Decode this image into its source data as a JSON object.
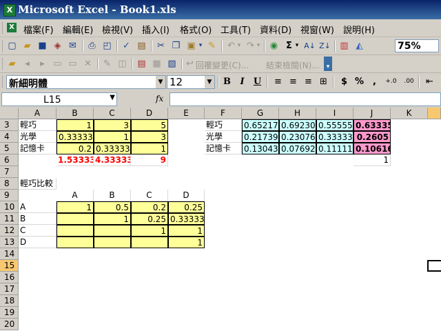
{
  "window": {
    "title": "Microsoft Excel - Book1.xls",
    "app_icon": "excel-icon"
  },
  "menu": [
    "檔案(F)",
    "編輯(E)",
    "檢視(V)",
    "插入(I)",
    "格式(O)",
    "工具(T)",
    "資料(D)",
    "視窗(W)",
    "說明(H)"
  ],
  "toolbar": {
    "zoom": "75%"
  },
  "reviewing_toolbar": {
    "reply_label": "回覆變更(C)...",
    "end_review_label": "結束檢閱(N)..."
  },
  "format_toolbar": {
    "font": "新細明體",
    "size": "12",
    "bold": "B",
    "italic": "I",
    "underline": "U",
    "currency": "$",
    "percent": "%",
    "comma": ","
  },
  "formula_bar": {
    "name_box": "L15",
    "fx": "fx",
    "content": ""
  },
  "columns": [
    "A",
    "B",
    "C",
    "D",
    "E",
    "F",
    "G",
    "H",
    "I",
    "J",
    "K"
  ],
  "rows": [
    "3",
    "4",
    "5",
    "6",
    "7",
    "8",
    "9",
    "10",
    "11",
    "12",
    "13",
    "14",
    "15",
    "16",
    "17",
    "18",
    "19",
    "20"
  ],
  "active_cell": "L15",
  "cells": {
    "A3": "輕巧",
    "B3": "1",
    "C3": "3",
    "D3": "5",
    "A4": "光學",
    "B4": "0.333333",
    "C4": "1",
    "D4": "3",
    "A5": "記憶卡",
    "B5": "0.2",
    "C5": "0.333333",
    "D5": "1",
    "B6": "1.53333",
    "C6": "4.33333",
    "D6": "9",
    "F3": "輕巧",
    "G3": "0.652174",
    "H3": "0.692308",
    "I3": "0.555556",
    "J3": "0.63335",
    "F4": "光學",
    "G4": "0.217391",
    "H4": "0.230769",
    "I4": "0.333333",
    "J4": "0.2605",
    "F5": "記憶卡",
    "G5": "0.130435",
    "H5": "0.076923",
    "I5": "0.111111",
    "J5": "0.10616",
    "J6": "1",
    "A8": "輕巧比較",
    "B9": "A",
    "C9": "B",
    "D9": "C",
    "E9": "D",
    "A10": "A",
    "B10": "1",
    "C10": "0.5",
    "D10": "0.2",
    "E10": "0.25",
    "A11": "B",
    "C11": "1",
    "D11": "0.25",
    "E11": "0.333333",
    "A12": "C",
    "D12": "1",
    "E12": "1",
    "A13": "D",
    "E13": "1"
  },
  "colors": {
    "yellow_fill": "#ffff99",
    "cyan_fill": "#ccffff",
    "pink_fill": "#ff99cc",
    "total_red": "#ff0000",
    "title_bar": "#0a246a"
  }
}
